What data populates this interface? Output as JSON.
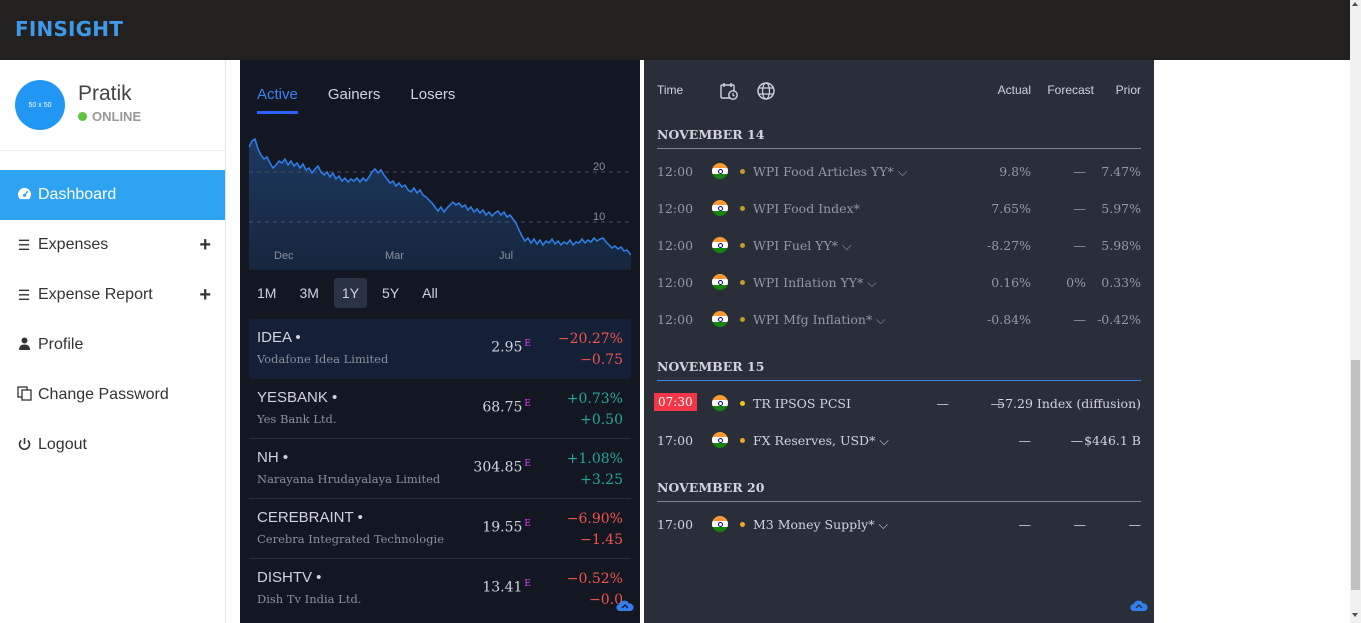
{
  "app": {
    "brand": "FINSIGHT"
  },
  "user": {
    "avatar_text": "50 x 50",
    "name": "Pratik",
    "status": "ONLINE",
    "status_color": "#5cc43c"
  },
  "sidebar": {
    "items": [
      {
        "label": "Dashboard",
        "icon": "gauge-icon",
        "active": true
      },
      {
        "label": "Expenses",
        "icon": "menu-icon",
        "expandable": true
      },
      {
        "label": "Expense Report",
        "icon": "menu-icon",
        "expandable": true
      },
      {
        "label": "Profile",
        "icon": "user-icon"
      },
      {
        "label": "Change Password",
        "icon": "copy-icon"
      },
      {
        "label": "Logout",
        "icon": "power-icon"
      }
    ]
  },
  "movers": {
    "tabs": [
      "Active",
      "Gainers",
      "Losers"
    ],
    "active_tab": "Active",
    "chart": {
      "x_labels": [
        "Dec",
        "Mar",
        "Jul"
      ],
      "y_labels": [
        "20",
        "10"
      ]
    },
    "ranges": [
      "1M",
      "3M",
      "1Y",
      "5Y",
      "All"
    ],
    "active_range": "1Y",
    "stocks": [
      {
        "symbol": "IDEA",
        "name": "Vodafone Idea Limited",
        "price": "2.95",
        "flag": "E",
        "pct": "−20.27%",
        "chg": "−0.75",
        "dir": "down"
      },
      {
        "symbol": "YESBANK",
        "name": "Yes Bank Ltd.",
        "price": "68.75",
        "flag": "E",
        "pct": "+0.73%",
        "chg": "+0.50",
        "dir": "up"
      },
      {
        "symbol": "NH",
        "name": "Narayana Hrudayalaya Limited",
        "price": "304.85",
        "flag": "E",
        "pct": "+1.08%",
        "chg": "+3.25",
        "dir": "up"
      },
      {
        "symbol": "CEREBRAINT",
        "name": "Cerebra Integrated Technologie",
        "price": "19.55",
        "flag": "E",
        "pct": "−6.90%",
        "chg": "−1.45",
        "dir": "down"
      },
      {
        "symbol": "DISHTV",
        "name": "Dish Tv India Ltd.",
        "price": "13.41",
        "flag": "E",
        "pct": "−0.52%",
        "chg": "−0.0",
        "dir": "down"
      }
    ]
  },
  "calendar": {
    "headers": {
      "time": "Time",
      "actual": "Actual",
      "forecast": "Forecast",
      "prior": "Prior"
    },
    "sections": [
      {
        "date": "NOVEMBER 14",
        "events": [
          {
            "time": "12:00",
            "name": "WPI Food Articles YY*",
            "chevron": true,
            "actual": "9.8%",
            "forecast": "—",
            "prior": "7.47%",
            "past": true,
            "importance_color": "#c69a2c"
          },
          {
            "time": "12:00",
            "name": "WPI Food Index*",
            "chevron": false,
            "actual": "7.65%",
            "forecast": "—",
            "prior": "5.97%",
            "past": true,
            "importance_color": "#c69a2c"
          },
          {
            "time": "12:00",
            "name": "WPI Fuel YY*",
            "chevron": true,
            "actual": "-8.27%",
            "forecast": "—",
            "prior": "5.98%",
            "past": true,
            "importance_color": "#c69a2c"
          },
          {
            "time": "12:00",
            "name": "WPI Inflation YY*",
            "chevron": true,
            "actual": "0.16%",
            "forecast": "0%",
            "prior": "0.33%",
            "past": true,
            "importance_color": "#c69a2c"
          },
          {
            "time": "12:00",
            "name": "WPI Mfg Inflation*",
            "chevron": true,
            "actual": "-0.84%",
            "forecast": "—",
            "prior": "-0.42%",
            "past": true,
            "importance_color": "#c69a2c"
          }
        ]
      },
      {
        "date": "NOVEMBER 15",
        "current": true,
        "events": [
          {
            "time": "07:30",
            "live": true,
            "name": "TR IPSOS PCSI",
            "chevron": false,
            "actual": "—",
            "forecast": "—",
            "prior": "57.29 Index (diffusion)",
            "importance_color": "#f5c518"
          },
          {
            "time": "17:00",
            "name": "FX Reserves, USD*",
            "chevron": true,
            "actual": "—",
            "forecast": "—",
            "prior": "$446.1 B",
            "importance_color": "#f5a623"
          }
        ]
      },
      {
        "date": "NOVEMBER 20",
        "events": [
          {
            "time": "17:00",
            "name": "M3 Money Supply*",
            "chevron": true,
            "actual": "—",
            "forecast": "—",
            "prior": "—",
            "importance_color": "#f5a623"
          }
        ]
      }
    ]
  },
  "colors": {
    "accent": "#2ea3f2",
    "brand": "#3e9ae8",
    "up": "#26a69a",
    "down": "#f05350",
    "live": "#f23645"
  }
}
